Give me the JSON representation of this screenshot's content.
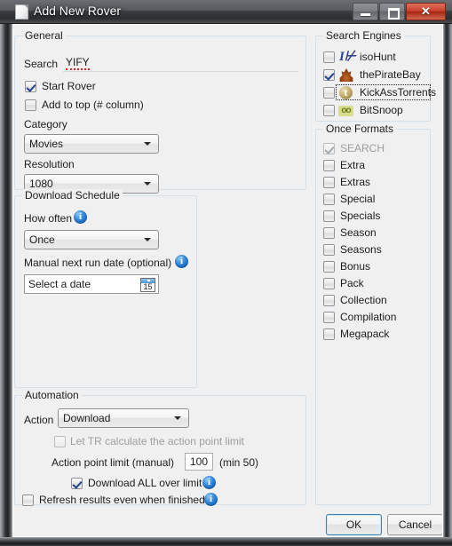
{
  "window": {
    "title": "Add New Rover",
    "icon": "document-icon",
    "controls": {
      "minimize": "minimize-button",
      "maximize": "maximize-button",
      "close": "close-button"
    }
  },
  "general": {
    "legend": "General",
    "search_label": "Search",
    "search_value": "YIFY",
    "search_misspelled": true,
    "checkboxes": [
      {
        "label": "Start Rover",
        "checked": true,
        "enabled": true
      },
      {
        "label": "Add to top (# column)",
        "checked": false,
        "enabled": true
      }
    ],
    "category_label": "Category",
    "category_value": "Movies",
    "resolution_label": "Resolution",
    "resolution_value": "1080"
  },
  "download_schedule": {
    "legend": "Download Schedule",
    "how_often_label": "How often",
    "how_often_value": "Once",
    "manual_date_label": "Manual next run date (optional)",
    "manual_date_placeholder": "Select a date",
    "calendar_day": "15"
  },
  "automation": {
    "legend": "Automation",
    "action_label": "Action",
    "action_value": "Download",
    "let_tr_label": "Let TR calculate the action point limit",
    "let_tr_checked": false,
    "let_tr_enabled": false,
    "point_limit_label": "Action point limit (manual)",
    "point_limit_value": "100",
    "point_limit_min_note": "(min 50)",
    "download_all_label": "Download ALL over limit",
    "download_all_checked": true,
    "refresh_label": "Refresh results even when finished",
    "refresh_checked": false
  },
  "search_engines": {
    "legend": "Search Engines",
    "items": [
      {
        "label": "isoHunt",
        "checked": false,
        "icon": "isohunt-icon",
        "focused": false
      },
      {
        "label": "thePirateBay",
        "checked": true,
        "icon": "piratebay-icon",
        "focused": false
      },
      {
        "label": "KickAssTorrents",
        "checked": false,
        "icon": "kickasstorrents-icon",
        "focused": true
      },
      {
        "label": "BitSnoop",
        "checked": false,
        "icon": "bitsnoop-icon",
        "focused": false
      }
    ]
  },
  "once_formats": {
    "legend": "Once Formats",
    "items": [
      {
        "label": "SEARCH",
        "checked": true,
        "enabled": false
      },
      {
        "label": "Extra",
        "checked": false,
        "enabled": true
      },
      {
        "label": "Extras",
        "checked": false,
        "enabled": true
      },
      {
        "label": "Special",
        "checked": false,
        "enabled": true
      },
      {
        "label": "Specials",
        "checked": false,
        "enabled": true
      },
      {
        "label": "Season",
        "checked": false,
        "enabled": true
      },
      {
        "label": "Seasons",
        "checked": false,
        "enabled": true
      },
      {
        "label": "Bonus",
        "checked": false,
        "enabled": true
      },
      {
        "label": "Pack",
        "checked": false,
        "enabled": true
      },
      {
        "label": "Collection",
        "checked": false,
        "enabled": true
      },
      {
        "label": "Compilation",
        "checked": false,
        "enabled": true
      },
      {
        "label": "Megapack",
        "checked": false,
        "enabled": true
      }
    ]
  },
  "footer": {
    "ok_label": "OK",
    "cancel_label": "Cancel"
  },
  "colors": {
    "accent": "#3c7fb1",
    "close_button": "#c9412c",
    "group_border": "#d5dfe8",
    "info_icon": "#2f86dd",
    "spellcheck_underline": "#e02020"
  }
}
